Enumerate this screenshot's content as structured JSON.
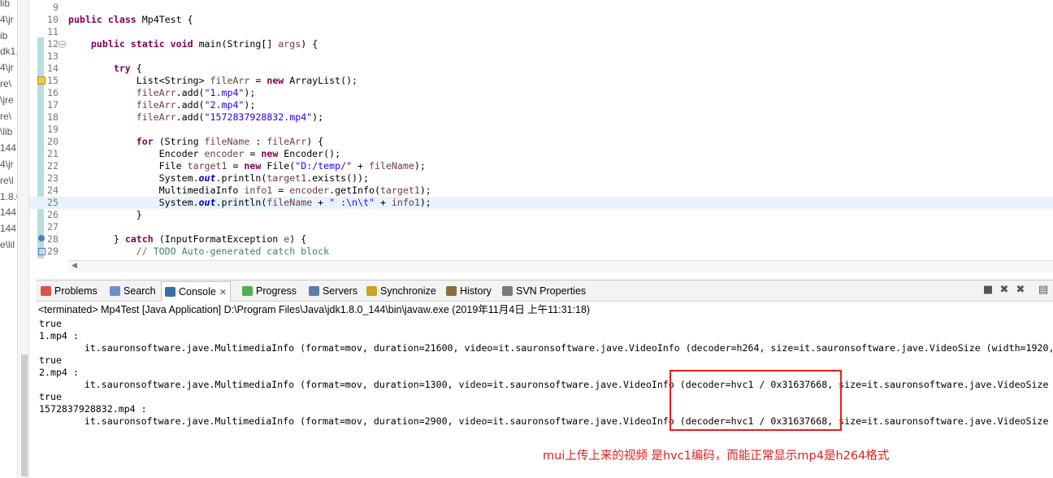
{
  "package_explorer": {
    "fragments": [
      "lib",
      "4\\jr",
      "ib",
      "dk1.8",
      "4\\jr",
      "re\\",
      "\\jre",
      "re\\",
      "\\lib",
      "144",
      "4\\jr",
      "re\\l",
      "1.8.0",
      "144",
      "144",
      "e\\lil"
    ]
  },
  "editor": {
    "lines": [
      {
        "n": "9",
        "code": []
      },
      {
        "n": "10",
        "code": [
          [
            "kw",
            "public "
          ],
          [
            "kw",
            "class "
          ],
          [
            "",
            "Mp4Test {"
          ]
        ]
      },
      {
        "n": "11",
        "code": []
      },
      {
        "n": "12",
        "code": [
          [
            "",
            "    "
          ],
          [
            "kw",
            "public "
          ],
          [
            "kw",
            "static "
          ],
          [
            "kw",
            "void "
          ],
          [
            "",
            "main(String[] "
          ],
          [
            "var",
            "args"
          ],
          [
            "",
            ") {"
          ]
        ]
      },
      {
        "n": "13",
        "code": []
      },
      {
        "n": "14",
        "code": [
          [
            "",
            "        "
          ],
          [
            "kw",
            "try "
          ],
          [
            "",
            "{"
          ]
        ]
      },
      {
        "n": "15",
        "code": [
          [
            "",
            "            List<String> "
          ],
          [
            "var",
            "fileArr"
          ],
          [
            "",
            " = "
          ],
          [
            "kw",
            "new "
          ],
          [
            "",
            "ArrayList();"
          ]
        ]
      },
      {
        "n": "16",
        "code": [
          [
            "",
            "            "
          ],
          [
            "var",
            "fileArr"
          ],
          [
            "",
            ".add("
          ],
          [
            "str",
            "\"1.mp4\""
          ],
          [
            "",
            ");"
          ]
        ]
      },
      {
        "n": "17",
        "code": [
          [
            "",
            "            "
          ],
          [
            "var",
            "fileArr"
          ],
          [
            "",
            ".add("
          ],
          [
            "str",
            "\"2.mp4\""
          ],
          [
            "",
            ");"
          ]
        ]
      },
      {
        "n": "18",
        "code": [
          [
            "",
            "            "
          ],
          [
            "var",
            "fileArr"
          ],
          [
            "",
            ".add("
          ],
          [
            "str",
            "\"1572837928832.mp4\""
          ],
          [
            "",
            ");"
          ]
        ]
      },
      {
        "n": "19",
        "code": []
      },
      {
        "n": "20",
        "code": [
          [
            "",
            "            "
          ],
          [
            "kw",
            "for "
          ],
          [
            "",
            "(String "
          ],
          [
            "var",
            "fileName"
          ],
          [
            "",
            " : "
          ],
          [
            "var",
            "fileArr"
          ],
          [
            "",
            ") {"
          ]
        ]
      },
      {
        "n": "21",
        "code": [
          [
            "",
            "                Encoder "
          ],
          [
            "var",
            "encoder"
          ],
          [
            "",
            " = "
          ],
          [
            "kw",
            "new "
          ],
          [
            "",
            "Encoder();"
          ]
        ]
      },
      {
        "n": "22",
        "code": [
          [
            "",
            "                File "
          ],
          [
            "var",
            "target1"
          ],
          [
            "",
            " = "
          ],
          [
            "kw",
            "new "
          ],
          [
            "",
            "File("
          ],
          [
            "str",
            "\"D:/temp/\""
          ],
          [
            "",
            " + "
          ],
          [
            "var",
            "fileName"
          ],
          [
            "",
            ");"
          ]
        ]
      },
      {
        "n": "23",
        "code": [
          [
            "",
            "                System."
          ],
          [
            "stat",
            "out"
          ],
          [
            "",
            ".println("
          ],
          [
            "var",
            "target1"
          ],
          [
            "",
            ".exists());"
          ]
        ]
      },
      {
        "n": "24",
        "code": [
          [
            "",
            "                MultimediaInfo "
          ],
          [
            "var",
            "info1"
          ],
          [
            "",
            " = "
          ],
          [
            "var",
            "encoder"
          ],
          [
            "",
            ".getInfo("
          ],
          [
            "var",
            "target1"
          ],
          [
            "",
            ");"
          ]
        ]
      },
      {
        "n": "25",
        "code": [
          [
            "",
            "                System."
          ],
          [
            "stat",
            "out"
          ],
          [
            "",
            ".println("
          ],
          [
            "var",
            "fileName"
          ],
          [
            "",
            " + "
          ],
          [
            "str",
            "\" :\\n\\t\""
          ],
          [
            "",
            " + "
          ],
          [
            "var",
            "info1"
          ],
          [
            "",
            ");"
          ]
        ]
      },
      {
        "n": "26",
        "code": [
          [
            "",
            "            }"
          ]
        ]
      },
      {
        "n": "27",
        "code": []
      },
      {
        "n": "28",
        "code": [
          [
            "",
            "        } "
          ],
          [
            "kw",
            "catch "
          ],
          [
            "",
            "(InputFormatException "
          ],
          [
            "var",
            "e"
          ],
          [
            "",
            ") {"
          ]
        ]
      },
      {
        "n": "29",
        "code": [
          [
            "",
            "            "
          ],
          [
            "cmt",
            "// TODO Auto-generated catch block"
          ]
        ]
      }
    ]
  },
  "console_view": {
    "tabs": [
      {
        "label": "Problems",
        "icon": "problems-icon",
        "color": "#d9534f"
      },
      {
        "label": "Search",
        "icon": "search-icon",
        "color": "#6d8fc7"
      },
      {
        "label": "Console",
        "icon": "console-icon",
        "color": "#3a6ea5",
        "active": true
      },
      {
        "label": "Progress",
        "icon": "progress-icon",
        "color": "#4caf50"
      },
      {
        "label": "Servers",
        "icon": "servers-icon",
        "color": "#5a7fa8"
      },
      {
        "label": "Synchronize",
        "icon": "synchronize-icon",
        "color": "#c9a227"
      },
      {
        "label": "History",
        "icon": "history-icon",
        "color": "#8c6d3f"
      },
      {
        "label": "SVN Properties",
        "icon": "svn-properties-icon",
        "color": "#7a7a7a"
      }
    ],
    "description": "<terminated> Mp4Test [Java Application] D:\\Program Files\\Java\\jdk1.8.0_144\\bin\\javaw.exe (2019年11月4日 上午11:31:18)",
    "output": [
      "true",
      "1.mp4 :",
      "        it.sauronsoftware.jave.MultimediaInfo (format=mov, duration=21600, video=it.sauronsoftware.jave.VideoInfo (decoder=h264, size=it.sauronsoftware.jave.VideoSize (width=1920,",
      "true",
      "2.mp4 :",
      "        it.sauronsoftware.jave.MultimediaInfo (format=mov, duration=1300, video=it.sauronsoftware.jave.VideoInfo (decoder=hvc1 / 0x31637668, size=it.sauronsoftware.jave.VideoSize",
      "true",
      "1572837928832.mp4 :",
      "        it.sauronsoftware.jave.MultimediaInfo (format=mov, duration=2900, video=it.sauronsoftware.jave.VideoInfo (decoder=hvc1 / 0x31637668, size=it.sauronsoftware.jave.VideoSize"
    ]
  },
  "annotation": {
    "text": "mui上传上来的视频 是hvc1编码，而能正常显示mp4是h264格式",
    "color": "#e31e1e"
  }
}
